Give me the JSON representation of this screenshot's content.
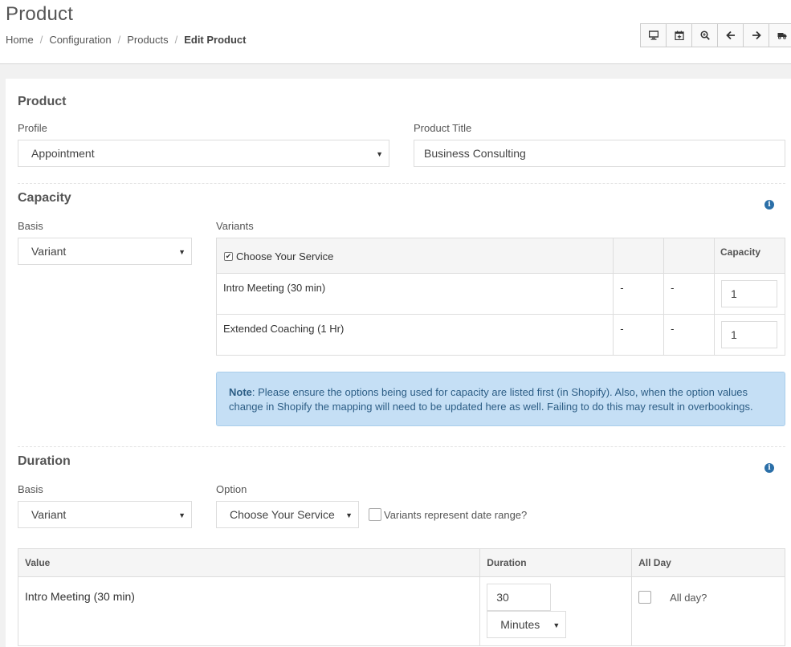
{
  "page": {
    "title": "Product",
    "breadcrumb": [
      "Home",
      "Configuration",
      "Products",
      "Edit Product"
    ]
  },
  "toolbar": {
    "icons": [
      "desktop-icon",
      "calendar-add-icon",
      "zoom-in-icon",
      "arrow-left-icon",
      "arrow-right-icon",
      "truck-icon"
    ]
  },
  "product": {
    "section_title": "Product",
    "profile_label": "Profile",
    "profile_value": "Appointment",
    "title_label": "Product Title",
    "title_value": "Business Consulting"
  },
  "capacity": {
    "section_title": "Capacity",
    "basis_label": "Basis",
    "basis_value": "Variant",
    "variants_label": "Variants",
    "table": {
      "header_option": "Choose Your Service",
      "header_capacity": "Capacity",
      "rows": [
        {
          "name": "Intro Meeting (30 min)",
          "col2": "-",
          "col3": "-",
          "capacity": "1"
        },
        {
          "name": "Extended Coaching (1 Hr)",
          "col2": "-",
          "col3": "-",
          "capacity": "1"
        }
      ]
    },
    "note_bold": "Note",
    "note_text": ": Please ensure the options being used for capacity are listed first (in Shopify). Also, when the option values change in Shopify the mapping will need to be updated here as well. Failing to do this may result in overbookings."
  },
  "duration": {
    "section_title": "Duration",
    "basis_label": "Basis",
    "basis_value": "Variant",
    "option_label": "Option",
    "option_value": "Choose Your Service",
    "date_range_label": "Variants represent date range?",
    "table": {
      "headers": [
        "Value",
        "Duration",
        "All Day"
      ],
      "rows": [
        {
          "value": "Intro Meeting (30 min)",
          "duration": "30",
          "unit": "Minutes",
          "allday_label": "All day?"
        }
      ]
    }
  },
  "colors": {
    "note_bg": "#c5dff5",
    "note_text": "#2c5d85",
    "info_icon": "#2b6fa8"
  }
}
